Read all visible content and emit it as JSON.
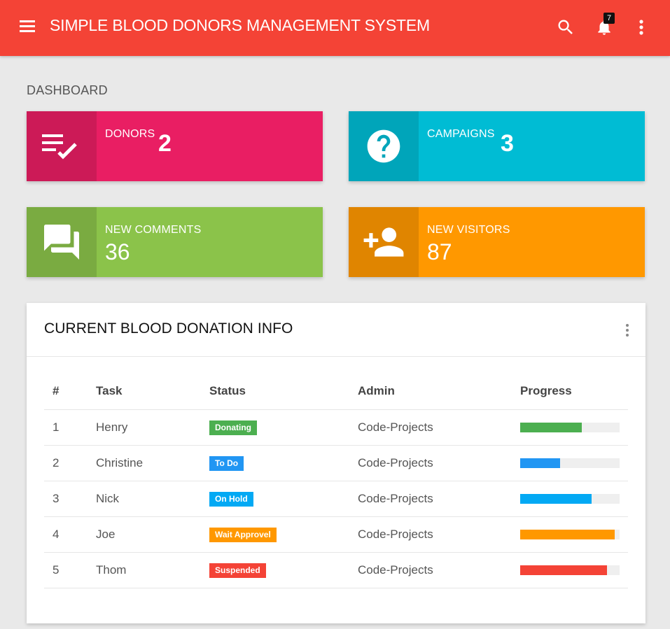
{
  "navbar": {
    "title": "SIMPLE BLOOD DONORS MANAGEMENT SYSTEM",
    "notification_count": "7",
    "color": "#f44336",
    "icons": [
      "menu-icon",
      "search-icon",
      "bell-icon",
      "more-vert-icon"
    ]
  },
  "page": {
    "title": "DASHBOARD"
  },
  "tiles": [
    {
      "label": "DONORS",
      "value": "2",
      "color": "#e91e63",
      "icon": "playlist-check-icon"
    },
    {
      "label": "CAMPAIGNS",
      "value": "3",
      "color": "#00bcd4",
      "icon": "help-circle-icon"
    },
    {
      "label": "NEW COMMENTS",
      "value": "36",
      "color": "#8bc34a",
      "icon": "forum-icon"
    },
    {
      "label": "NEW VISITORS",
      "value": "87",
      "color": "#ff9800",
      "icon": "person-add-icon"
    }
  ],
  "card": {
    "title": "CURRENT BLOOD DONATION INFO",
    "columns": [
      "#",
      "Task",
      "Status",
      "Admin",
      "Progress"
    ],
    "rows": [
      {
        "num": "1",
        "task": "Henry",
        "status": "Donating",
        "status_color": "#4caf50",
        "admin": "Code-Projects",
        "progress": 0.62,
        "progress_color": "#4caf50"
      },
      {
        "num": "2",
        "task": "Christine",
        "status": "To Do",
        "status_color": "#2196f3",
        "admin": "Code-Projects",
        "progress": 0.4,
        "progress_color": "#2196f3"
      },
      {
        "num": "3",
        "task": "Nick",
        "status": "On Hold",
        "status_color": "#03a9f4",
        "admin": "Code-Projects",
        "progress": 0.72,
        "progress_color": "#03a9f4"
      },
      {
        "num": "4",
        "task": "Joe",
        "status": "Wait Approvel",
        "status_color": "#ff9800",
        "admin": "Code-Projects",
        "progress": 0.95,
        "progress_color": "#ff9800"
      },
      {
        "num": "5",
        "task": "Thom",
        "status": "Suspended",
        "status_color": "#f44336",
        "admin": "Code-Projects",
        "progress": 0.87,
        "progress_color": "#f44336"
      }
    ]
  }
}
